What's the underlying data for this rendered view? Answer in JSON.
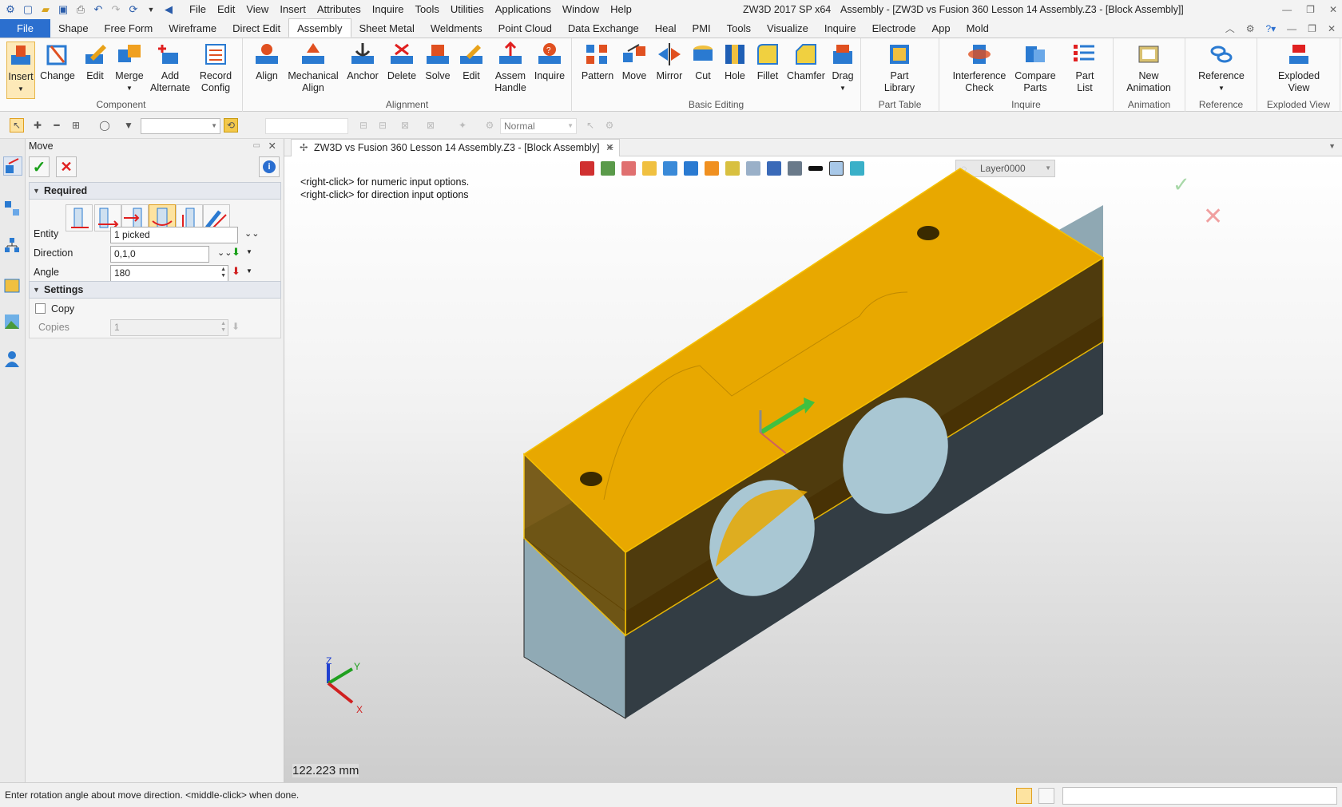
{
  "titlebar": {
    "app_title": "ZW3D 2017 SP x64",
    "doc_title": "Assembly - [ZW3D vs Fusion 360 Lesson 14 Assembly.Z3 - [Block Assembly]]",
    "menu": [
      "File",
      "Edit",
      "View",
      "Insert",
      "Attributes",
      "Inquire",
      "Tools",
      "Utilities",
      "Applications",
      "Window",
      "Help"
    ]
  },
  "tabs": [
    "File",
    "Shape",
    "Free Form",
    "Wireframe",
    "Direct Edit",
    "Assembly",
    "Sheet Metal",
    "Weldments",
    "Point Cloud",
    "Data Exchange",
    "Heal",
    "PMI",
    "Tools",
    "Visualize",
    "Inquire",
    "Electrode",
    "App",
    "Mold"
  ],
  "ribbon": {
    "groups": {
      "component": "Component",
      "alignment": "Alignment",
      "basic_editing": "Basic Editing",
      "part_table": "Part Table",
      "inquire": "Inquire",
      "animation": "Animation",
      "reference": "Reference",
      "exploded_view": "Exploded View"
    },
    "buttons": {
      "insert": "Insert",
      "change": "Change",
      "edit": "Edit",
      "merge": "Merge",
      "add_alternate_1": "Add",
      "add_alternate_2": "Alternate",
      "record_config_1": "Record",
      "record_config_2": "Config",
      "align": "Align",
      "mech_align_1": "Mechanical",
      "mech_align_2": "Align",
      "anchor": "Anchor",
      "delete": "Delete",
      "solve": "Solve",
      "edit2": "Edit",
      "assem_handle_1": "Assem",
      "assem_handle_2": "Handle",
      "inquire": "Inquire",
      "pattern": "Pattern",
      "move": "Move",
      "mirror": "Mirror",
      "cut": "Cut",
      "hole": "Hole",
      "fillet": "Fillet",
      "chamfer": "Chamfer",
      "drag": "Drag",
      "part_library_1": "Part",
      "part_library_2": "Library",
      "interference_1": "Interference",
      "interference_2": "Check",
      "compare_1": "Compare",
      "compare_2": "Parts",
      "partlist_1": "Part",
      "partlist_2": "List",
      "animation_1": "New",
      "animation_2": "Animation",
      "reference": "Reference",
      "exploded_1": "Exploded",
      "exploded_2": "View"
    }
  },
  "toolbar2": {
    "render_mode": "Normal"
  },
  "panel": {
    "title": "Move",
    "required": "Required",
    "entity_label": "Entity",
    "entity_value": "1 picked",
    "direction_label": "Direction",
    "direction_value": "0,1,0",
    "angle_label": "Angle",
    "angle_value": "180",
    "settings": "Settings",
    "copy_label": "Copy",
    "copies_label": "Copies",
    "copies_value": "1"
  },
  "viewport": {
    "doc_tab": "ZW3D vs Fusion 360 Lesson 14 Assembly.Z3 - [Block Assembly]",
    "hint1": "<right-click> for numeric input options.",
    "hint2": "<right-click> for direction input options",
    "layer": "Layer0000",
    "dimension": "122.223 mm",
    "triad": {
      "x": "X",
      "y": "Y",
      "z": "Z"
    }
  },
  "status": {
    "message": "Enter rotation angle about move direction.  <middle-click> when done."
  },
  "colors": {
    "accent": "#2b6fcf",
    "selection": "#e8a800",
    "bottom_top": "#8fa8b3",
    "bottom_dark": "#333d44"
  }
}
